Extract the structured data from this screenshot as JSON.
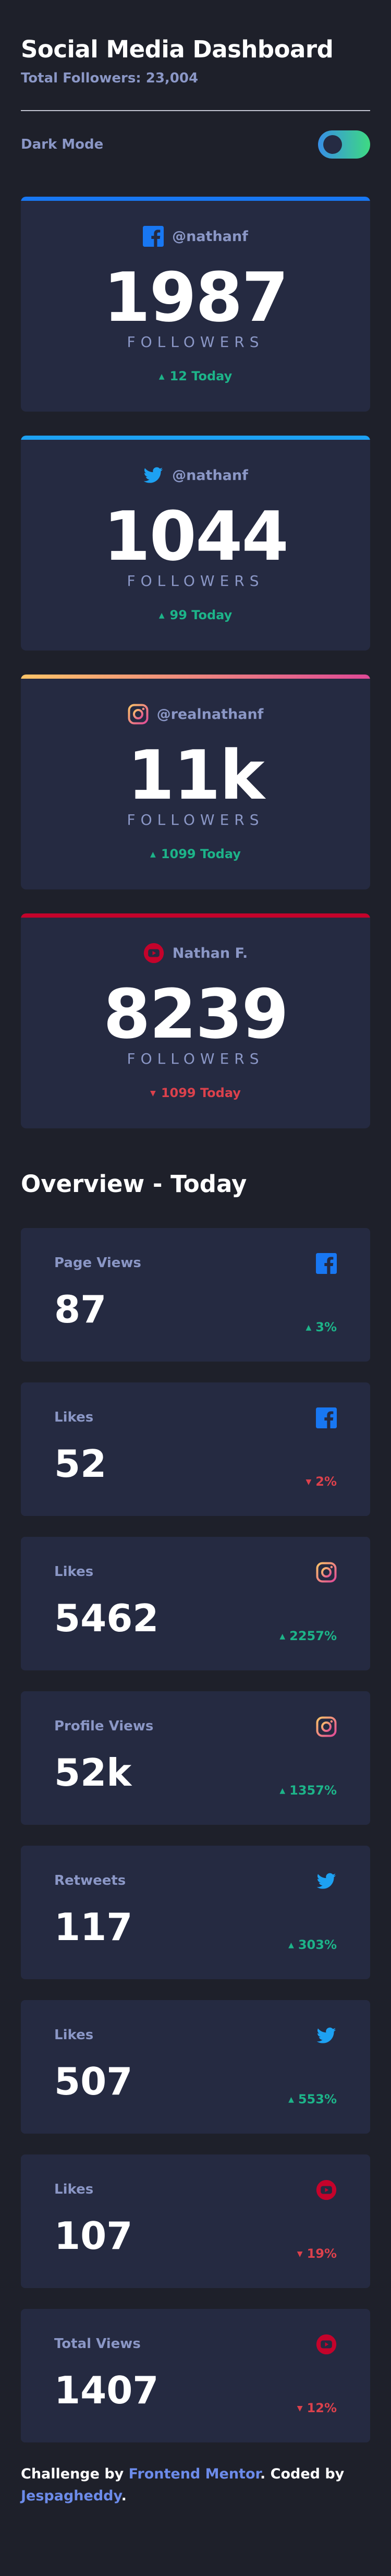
{
  "header": {
    "title": "Social Media Dashboard",
    "total_followers": "Total Followers: 23,004"
  },
  "dark_mode": {
    "label": "Dark Mode",
    "enabled": true
  },
  "colors": {
    "facebook": "#1877f2",
    "twitter": "#1da1f2",
    "instagram_start": "#fdc468",
    "instagram_end": "#df4996",
    "youtube": "#c4032b",
    "up": "#1db489",
    "down": "#dc414c"
  },
  "cards": [
    {
      "network": "facebook",
      "icon": "facebook-icon",
      "handle": "@nathanf",
      "count": "1987",
      "unit": "FOLLOWERS",
      "delta": "12 Today",
      "trend": "up"
    },
    {
      "network": "twitter",
      "icon": "twitter-icon",
      "handle": "@nathanf",
      "count": "1044",
      "unit": "FOLLOWERS",
      "delta": "99 Today",
      "trend": "up"
    },
    {
      "network": "instagram",
      "icon": "instagram-icon",
      "handle": "@realnathanf",
      "count": "11k",
      "unit": "FOLLOWERS",
      "delta": "1099 Today",
      "trend": "up"
    },
    {
      "network": "youtube",
      "icon": "youtube-icon",
      "handle": "Nathan F.",
      "count": "8239",
      "unit": "FOLLOWERS",
      "delta": "1099 Today",
      "trend": "down"
    }
  ],
  "overview": {
    "title": "Overview - Today",
    "items": [
      {
        "label": "Page Views",
        "icon": "facebook-icon",
        "value": "87",
        "delta": "3%",
        "trend": "up"
      },
      {
        "label": "Likes",
        "icon": "facebook-icon",
        "value": "52",
        "delta": "2%",
        "trend": "down"
      },
      {
        "label": "Likes",
        "icon": "instagram-icon",
        "value": "5462",
        "delta": "2257%",
        "trend": "up"
      },
      {
        "label": "Profile Views",
        "icon": "instagram-icon",
        "value": "52k",
        "delta": "1357%",
        "trend": "up"
      },
      {
        "label": "Retweets",
        "icon": "twitter-icon",
        "value": "117",
        "delta": "303%",
        "trend": "up"
      },
      {
        "label": "Likes",
        "icon": "twitter-icon",
        "value": "507",
        "delta": "553%",
        "trend": "up"
      },
      {
        "label": "Likes",
        "icon": "youtube-icon",
        "value": "107",
        "delta": "19%",
        "trend": "down"
      },
      {
        "label": "Total Views",
        "icon": "youtube-icon",
        "value": "1407",
        "delta": "12%",
        "trend": "down"
      }
    ]
  },
  "footer": {
    "prefix": "Challenge by ",
    "link1": "Frontend Mentor",
    "middle": ". Coded by ",
    "link2": "Jespagheddy",
    "suffix": "."
  }
}
